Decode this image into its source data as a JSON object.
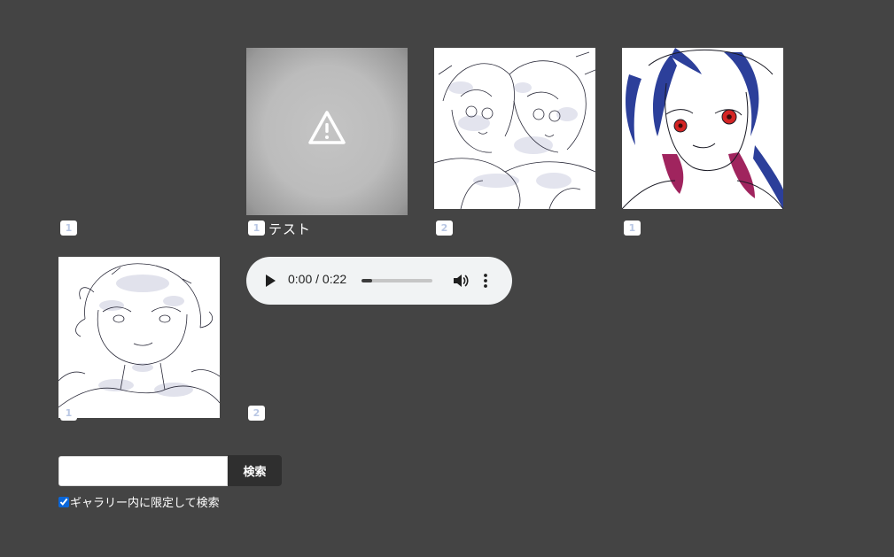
{
  "gallery": {
    "items": [
      {
        "count": "1"
      },
      {
        "count": "1",
        "caption": "テスト",
        "state": "blurred-warning"
      },
      {
        "count": "2"
      },
      {
        "count": "1"
      },
      {
        "count": "1"
      },
      {
        "count": "2"
      }
    ]
  },
  "audio_player": {
    "time_display": "0:00 / 0:22",
    "progress": 0.15,
    "icons": [
      "play-icon",
      "volume-icon",
      "more-options-icon"
    ]
  },
  "search": {
    "input_value": "",
    "button_label": "検索",
    "limit_checkbox_checked": true,
    "limit_checkbox_label": "ギャラリー内に限定して検索"
  },
  "colors": {
    "background": "#444444",
    "badge_text": "#b9c7e4",
    "accent_hair_blue": "#2c3f9a",
    "accent_hair_magenta": "#a0245e",
    "accent_eye_red": "#d42424"
  }
}
